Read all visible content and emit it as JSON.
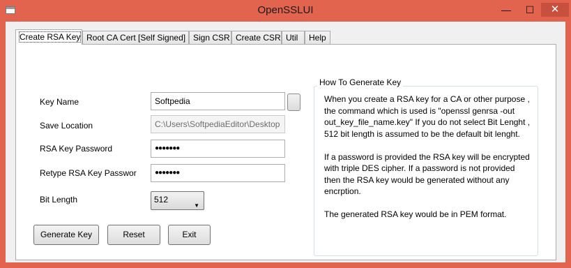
{
  "window": {
    "title": "OpenSSLUI",
    "min_glyph": "—",
    "max_glyph": "☐",
    "close_glyph": "✕"
  },
  "tabs": [
    {
      "label": "Create RSA Key"
    },
    {
      "label": "Root CA Cert [Self Signed]"
    },
    {
      "label": "Sign CSR"
    },
    {
      "label": "Create CSR"
    },
    {
      "label": "Util"
    },
    {
      "label": "Help"
    }
  ],
  "form": {
    "key_name_label": "Key Name",
    "key_name_value": "Softpedia",
    "save_location_label": "Save Location",
    "save_location_value": "C:\\Users\\SoftpediaEditor\\Desktop",
    "password_label": "RSA Key Password",
    "password_value": "●●●●●●●",
    "retype_label": "Retype RSA Key Passwor",
    "retype_value": "●●●●●●●",
    "bit_length_label": "Bit Length",
    "bit_length_value": "512"
  },
  "help": {
    "title": "How To Generate Key",
    "p1": "When you create a RSA key for a CA or other purpose , the command which is used is \"openssl genrsa -out out_key_file_name.key\" If you do not select Bit Lenght , 512 bit length is assumed to be the default bit lenght.",
    "p2": "If a password is provided the RSA key will be encrypted with triple DES cipher. If a password is not provided then the RSA key would be generated without any encrption.",
    "p3": "The generated RSA key would be in PEM format."
  },
  "buttons": {
    "generate": "Generate Key",
    "reset": "Reset",
    "exit": "Exit"
  },
  "colors": {
    "frame": "#e2644e",
    "close": "#c7503f"
  }
}
